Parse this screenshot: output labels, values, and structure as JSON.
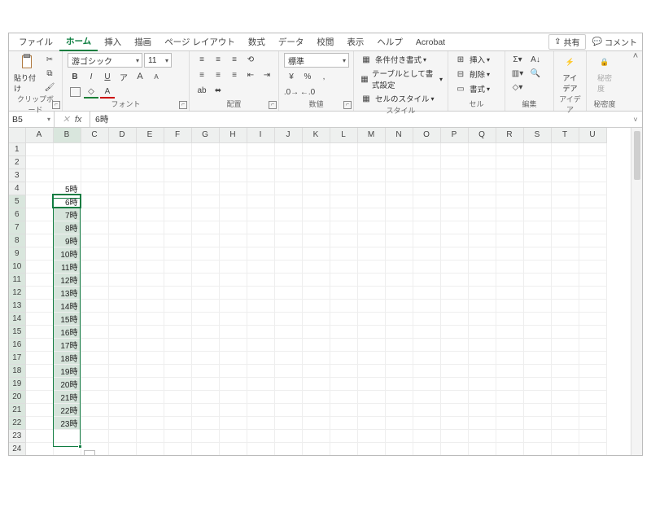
{
  "tabs": {
    "items": [
      "ファイル",
      "ホーム",
      "挿入",
      "描画",
      "ページ レイアウト",
      "数式",
      "データ",
      "校閲",
      "表示",
      "ヘルプ",
      "Acrobat"
    ],
    "active": 1,
    "share": "共有",
    "comment": "コメント"
  },
  "ribbon": {
    "clipboard": {
      "label": "クリップボード",
      "paste": "貼り付け"
    },
    "font": {
      "label": "フォント",
      "name": "游ゴシック",
      "size": "11",
      "bold": "B",
      "italic": "I",
      "underline": "U",
      "ruby": "ア",
      "grow": "A",
      "shrink": "A"
    },
    "align": {
      "label": "配置",
      "wrap": "ab"
    },
    "number": {
      "label": "数値",
      "format": "標準",
      "percent": "%",
      "comma": ","
    },
    "styles": {
      "label": "スタイル",
      "cond": "条件付き書式",
      "table": "テーブルとして書式設定",
      "cell": "セルのスタイル"
    },
    "cells": {
      "label": "セル",
      "insert": "挿入",
      "delete": "削除",
      "format": "書式"
    },
    "editing": {
      "label": "編集"
    },
    "ideas": {
      "label": "アイデア",
      "btn": "アイ\nデア"
    },
    "sensitivity": {
      "label": "秘密度",
      "btn": "秘密\n度"
    }
  },
  "formula_bar": {
    "name": "B5",
    "value": "6時"
  },
  "columns": [
    "A",
    "B",
    "C",
    "D",
    "E",
    "F",
    "G",
    "H",
    "I",
    "J",
    "K",
    "L",
    "M",
    "N",
    "O",
    "P",
    "Q",
    "R",
    "S",
    "T",
    "U"
  ],
  "row_count": 25,
  "cells": {
    "B4": "5時",
    "B5": "6時",
    "B6": "7時",
    "B7": "8時",
    "B8": "9時",
    "B9": "10時",
    "B10": "11時",
    "B11": "12時",
    "B12": "13時",
    "B13": "14時",
    "B14": "15時",
    "B15": "16時",
    "B16": "17時",
    "B17": "18時",
    "B18": "19時",
    "B19": "20時",
    "B20": "21時",
    "B21": "22時",
    "B22": "23時"
  },
  "selection": {
    "col": "B",
    "start": 5,
    "end": 22,
    "active_row": 5
  }
}
